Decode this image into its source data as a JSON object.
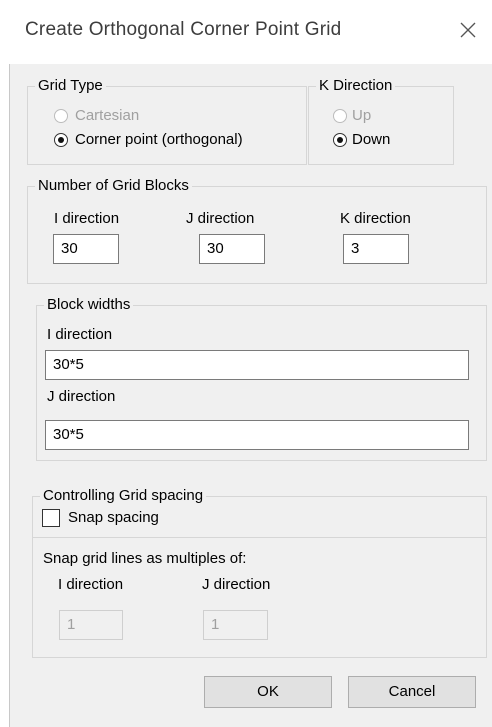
{
  "window": {
    "title": "Create Orthogonal Corner Point Grid",
    "close_icon": "close-icon"
  },
  "grid_type": {
    "legend": "Grid Type",
    "options": [
      {
        "label": "Cartesian",
        "selected": false,
        "enabled": false
      },
      {
        "label": "Corner point (orthogonal)",
        "selected": true,
        "enabled": true
      }
    ]
  },
  "k_direction": {
    "legend": "K Direction",
    "options": [
      {
        "label": "Up",
        "selected": false,
        "enabled": false
      },
      {
        "label": "Down",
        "selected": true,
        "enabled": true
      }
    ]
  },
  "blocks": {
    "legend": "Number of Grid Blocks",
    "i_label": "I direction",
    "i_value": "30",
    "j_label": "J direction",
    "j_value": "30",
    "k_label": "K direction",
    "k_value": "3"
  },
  "widths": {
    "legend": "Block widths",
    "i_label": "I direction",
    "i_value": "30*5",
    "j_label": "J direction",
    "j_value": "30*5"
  },
  "spacing": {
    "legend": "Controlling Grid spacing",
    "snap_label": "Snap spacing",
    "snap_checked": false,
    "multiples_label": "Snap grid lines as multiples of:",
    "i_label": "I direction",
    "i_value": "1",
    "j_label": "J direction",
    "j_value": "1"
  },
  "buttons": {
    "ok": "OK",
    "cancel": "Cancel"
  }
}
